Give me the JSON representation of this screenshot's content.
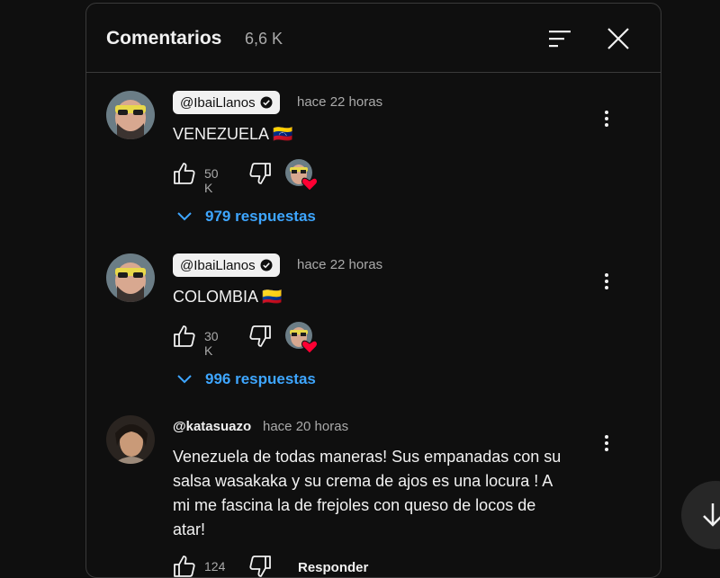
{
  "header": {
    "title": "Comentarios",
    "count": "6,6 K"
  },
  "comments": [
    {
      "author": "@IbaiLlanos",
      "verified": true,
      "time": "hace 22 horas",
      "text": "VENEZUELA 🇻🇪",
      "likes": "50 K",
      "replies": "979 respuestas"
    },
    {
      "author": "@IbaiLlanos",
      "verified": true,
      "time": "hace 22 horas",
      "text": "COLOMBIA 🇨🇴",
      "likes": "30 K",
      "replies": "996 respuestas"
    },
    {
      "author": "@katasuazo",
      "verified": false,
      "time": "hace 20 horas",
      "text_lines": [
        "Venezuela de todas maneras! Sus empanadas con su",
        "salsa wasakaka y su crema de ajos es una locura ! A",
        "mi me fascina la de frejoles con queso de locos de",
        "atar!"
      ],
      "likes": "124",
      "reply_label": "Responder"
    }
  ],
  "icons": {
    "sort": "sort-icon",
    "close": "close-icon",
    "like": "thumbs-up-icon",
    "dislike": "thumbs-down-icon",
    "heart": "creator-heart-icon",
    "expand": "chevron-down-icon",
    "scroll": "arrow-down-icon"
  },
  "colors": {
    "background": "#0f0f0f",
    "link": "#3ea6ff",
    "heart": "#ff0033"
  }
}
